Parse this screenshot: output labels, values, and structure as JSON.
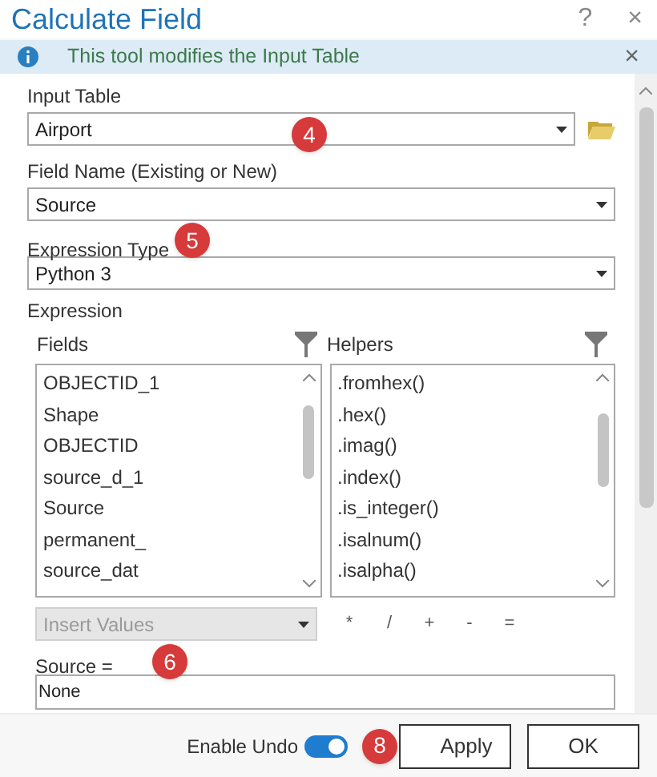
{
  "window": {
    "title": "Calculate Field",
    "help": "?",
    "close": "×"
  },
  "info_bar": {
    "message": "This tool modifies the Input Table",
    "close": "×"
  },
  "input_table": {
    "label": "Input Table",
    "value": "Airport",
    "callout": "4"
  },
  "field_name": {
    "label": "Field Name (Existing or New)",
    "value": "Source"
  },
  "expression_type": {
    "label": "Expression Type",
    "value": "Python 3",
    "callout": "5"
  },
  "expression": {
    "label": "Expression",
    "fields": {
      "title": "Fields",
      "items": [
        "OBJECTID_1",
        "Shape",
        "OBJECTID",
        "source_d_1",
        "Source",
        "permanent_",
        "source_dat"
      ]
    },
    "helpers": {
      "title": "Helpers",
      "items": [
        ".fromhex()",
        ".hex()",
        ".imag()",
        ".index()",
        ".is_integer()",
        ".isalnum()",
        ".isalpha()"
      ]
    },
    "insert_values": {
      "placeholder": "Insert Values",
      "disabled": true
    },
    "operators": [
      "*",
      "/",
      "+",
      "-",
      "="
    ],
    "target_label": "Source =",
    "target_callout": "6",
    "value": "None"
  },
  "footer": {
    "enable_undo": {
      "label": "Enable Undo",
      "on": true
    },
    "apply": "Apply",
    "apply_callout": "8",
    "ok": "OK"
  }
}
